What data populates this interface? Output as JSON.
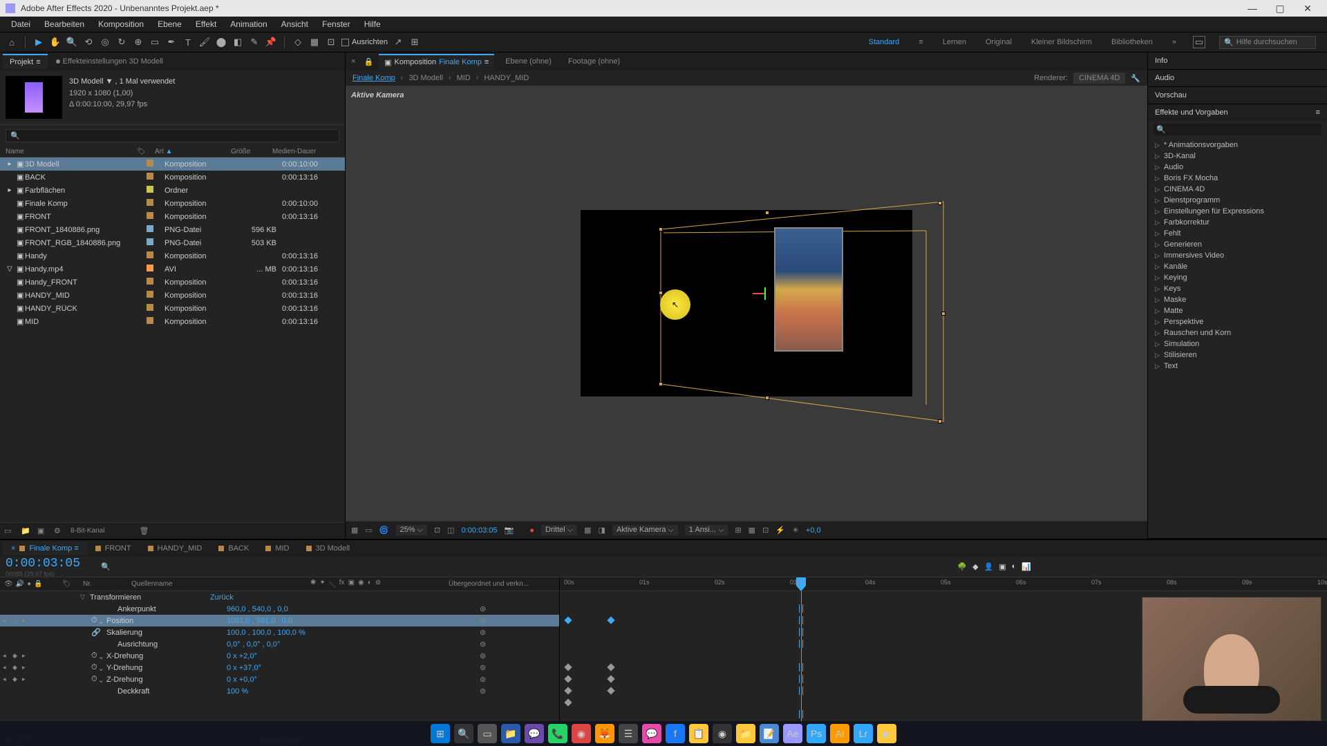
{
  "title": "Adobe After Effects 2020 - Unbenanntes Projekt.aep *",
  "menu": [
    "Datei",
    "Bearbeiten",
    "Komposition",
    "Ebene",
    "Effekt",
    "Animation",
    "Ansicht",
    "Fenster",
    "Hilfe"
  ],
  "toolbar": {
    "align": "Ausrichten"
  },
  "workspaces": [
    "Standard",
    "Lernen",
    "Original",
    "Kleiner Bildschirm",
    "Bibliotheken"
  ],
  "search_help": "Hilfe durchsuchen",
  "project_panel": {
    "tabs": {
      "projekt": "Projekt",
      "effekt": "Effekteinstellungen 3D Modell"
    },
    "info": {
      "name": "3D Modell ▼ , 1 Mal verwendet",
      "res": "1920 x 1080 (1,00)",
      "dur": "Δ 0:00:10:00, 29,97 fps"
    },
    "cols": {
      "name": "Name",
      "art": "Art",
      "groesse": "Größe",
      "medien": "Medien-Dauer"
    },
    "items": [
      {
        "name": "3D Modell",
        "art": "Komposition",
        "gr": "",
        "md": "0:00:10:00",
        "lbl": "#b88a4a",
        "sel": true,
        "ic": "▸"
      },
      {
        "name": "BACK",
        "art": "Komposition",
        "gr": "",
        "md": "0:00:13:16",
        "lbl": "#b88a4a"
      },
      {
        "name": "Farbflächen",
        "art": "Ordner",
        "gr": "",
        "md": "",
        "lbl": "#c8c84a",
        "ic": "▸"
      },
      {
        "name": "Finale Komp",
        "art": "Komposition",
        "gr": "",
        "md": "0:00:10:00",
        "lbl": "#b88a4a"
      },
      {
        "name": "FRONT",
        "art": "Komposition",
        "gr": "",
        "md": "0:00:13:16",
        "lbl": "#b88a4a"
      },
      {
        "name": "FRONT_1840886.png",
        "art": "PNG-Datei",
        "gr": "596 KB",
        "md": "",
        "lbl": "#7aa8c8"
      },
      {
        "name": "FRONT_RGB_1840886.png",
        "art": "PNG-Datei",
        "gr": "503 KB",
        "md": "",
        "lbl": "#7aa8c8"
      },
      {
        "name": "Handy",
        "art": "Komposition",
        "gr": "",
        "md": "0:00:13:16",
        "lbl": "#b88a4a"
      },
      {
        "name": "Handy.mp4",
        "art": "AVI",
        "gr": "... MB",
        "md": "0:00:13:16",
        "lbl": "#ff9944",
        "ic": "▽"
      },
      {
        "name": "Handy_FRONT",
        "art": "Komposition",
        "gr": "",
        "md": "0:00:13:16",
        "lbl": "#b88a4a"
      },
      {
        "name": "HANDY_MID",
        "art": "Komposition",
        "gr": "",
        "md": "0:00:13:16",
        "lbl": "#b88a4a"
      },
      {
        "name": "HANDY_RÜCK",
        "art": "Komposition",
        "gr": "",
        "md": "0:00:13:16",
        "lbl": "#b88a4a"
      },
      {
        "name": "MID",
        "art": "Komposition",
        "gr": "",
        "md": "0:00:13:16",
        "lbl": "#b88a4a"
      }
    ],
    "footer": "8-Bit-Kanal"
  },
  "comp": {
    "tabs": {
      "komp_pre": "Komposition",
      "komp_name": "Finale Komp",
      "ebene": "Ebene (ohne)",
      "footage": "Footage (ohne)"
    },
    "bread": [
      "Finale Komp",
      "3D Modell",
      "MID",
      "HANDY_MID"
    ],
    "renderer_lbl": "Renderer:",
    "renderer": "CINEMA 4D",
    "camera": "Aktive Kamera",
    "foot": {
      "zoom": "25%",
      "time": "0:00:03:05",
      "res": "Drittel",
      "cam": "Aktive Kamera",
      "views": "1 Ansi...",
      "exp": "+0,0"
    }
  },
  "right": {
    "panels": [
      "Info",
      "Audio",
      "Vorschau",
      "Effekte und Vorgaben"
    ],
    "effects": [
      "* Animationsvorgaben",
      "3D-Kanal",
      "Audio",
      "Boris FX Mocha",
      "CINEMA 4D",
      "Dienstprogramm",
      "Einstellungen für Expressions",
      "Farbkorrektur",
      "Fehlt",
      "Generieren",
      "Immersives Video",
      "Kanäle",
      "Keying",
      "Keys",
      "Maske",
      "Matte",
      "Perspektive",
      "Rauschen und Korn",
      "Simulation",
      "Stilisieren",
      "Text"
    ]
  },
  "timeline": {
    "tabs": [
      "Finale Komp",
      "FRONT",
      "HANDY_MID",
      "BACK",
      "MID",
      "3D Modell"
    ],
    "time": "0:00:03:05",
    "frame": "00095 (29,97 fps)",
    "cols": {
      "nr": "Nr.",
      "quelle": "Quellenname",
      "parent": "Übergeordnet und verkn..."
    },
    "group": "Transformieren",
    "group_val": "Zurück",
    "rows": [
      {
        "name": "Ankerpunkt",
        "val": "960,0 , 540,0 , 0,0",
        "kf": ""
      },
      {
        "name": "Position",
        "val": "1081,0 , 591,0 , 0,0",
        "kf": "◇",
        "sel": true,
        "arrows": true,
        "sw": true
      },
      {
        "name": "Skalierung",
        "val": "100,0 , 100,0 , 100,0 %",
        "kf": "",
        "link": true
      },
      {
        "name": "Ausrichtung",
        "val": "0,0° , 0,0° , 0,0°",
        "kf": ""
      },
      {
        "name": "X-Drehung",
        "val": "0 x +2,0°",
        "kf": "◆",
        "arrows": true,
        "sw": true
      },
      {
        "name": "Y-Drehung",
        "val": "0 x +37,0°",
        "kf": "◆",
        "arrows": true,
        "sw": true
      },
      {
        "name": "Z-Drehung",
        "val": "0 x +0,0°",
        "kf": "◆",
        "arrows": true,
        "sw": true
      },
      {
        "name": "Deckkraft",
        "val": "100 %",
        "kf": ""
      }
    ],
    "ticks": [
      "00s",
      "01s",
      "02s",
      "03s",
      "04s",
      "05s",
      "06s",
      "07s",
      "08s",
      "09s",
      "10s"
    ],
    "foot": "Schalter/Modi"
  },
  "taskbar": [
    {
      "bg": "#0078d4",
      "tx": "⊞"
    },
    {
      "bg": "#333",
      "tx": "🔍"
    },
    {
      "bg": "#555",
      "tx": "▭"
    },
    {
      "bg": "#2a5aaa",
      "tx": "📁"
    },
    {
      "bg": "#6a4aaa",
      "tx": "💬"
    },
    {
      "bg": "#25d366",
      "tx": "📞"
    },
    {
      "bg": "#d44",
      "tx": "◉"
    },
    {
      "bg": "#ff9500",
      "tx": "🦊"
    },
    {
      "bg": "#444",
      "tx": "☰"
    },
    {
      "bg": "#e84aaa",
      "tx": "💬"
    },
    {
      "bg": "#1877f2",
      "tx": "f"
    },
    {
      "bg": "#ffc83d",
      "tx": "📋"
    },
    {
      "bg": "#333",
      "tx": "◉"
    },
    {
      "bg": "#ffc83d",
      "tx": "📁"
    },
    {
      "bg": "#4a8ad4",
      "tx": "📝"
    },
    {
      "bg": "#9999ff",
      "tx": "Ae"
    },
    {
      "bg": "#31a8ff",
      "tx": "Ps"
    },
    {
      "bg": "#ff9a00",
      "tx": "Ai"
    },
    {
      "bg": "#31a8ff",
      "tx": "Lr"
    },
    {
      "bg": "#ffc83d",
      "tx": "▶"
    }
  ]
}
